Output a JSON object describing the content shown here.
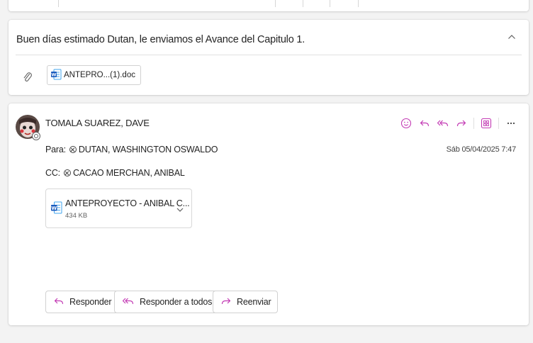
{
  "previous_message": {
    "subject_preview": "Buen días estimado Dutan, le enviamos el Avance del Capitulo 1.",
    "attachment_name": "ANTEPRO...(1).doc"
  },
  "message": {
    "sender": "TOMALA SUAREZ, DAVE",
    "to_label": "Para:",
    "to": "DUTAN, WASHINGTON OSWALDO",
    "cc_label": "CC:",
    "cc": "CACAO MERCHAN, ANIBAL",
    "date": "Sáb 05/04/2025 7:47",
    "attachment": {
      "name": "ANTEPROYECTO - ANIBAL C...",
      "size": "434 KB"
    },
    "actions": [
      "smile-icon",
      "reply-icon",
      "reply-all-icon",
      "forward-icon",
      "apps-icon",
      "more-icon"
    ]
  },
  "buttons": {
    "reply": "Responder",
    "reply_all": "Responder a todos",
    "forward": "Reenviar"
  },
  "colors": {
    "accent": "#c239b3",
    "word_blue": "#185abd",
    "text": "#242424"
  }
}
